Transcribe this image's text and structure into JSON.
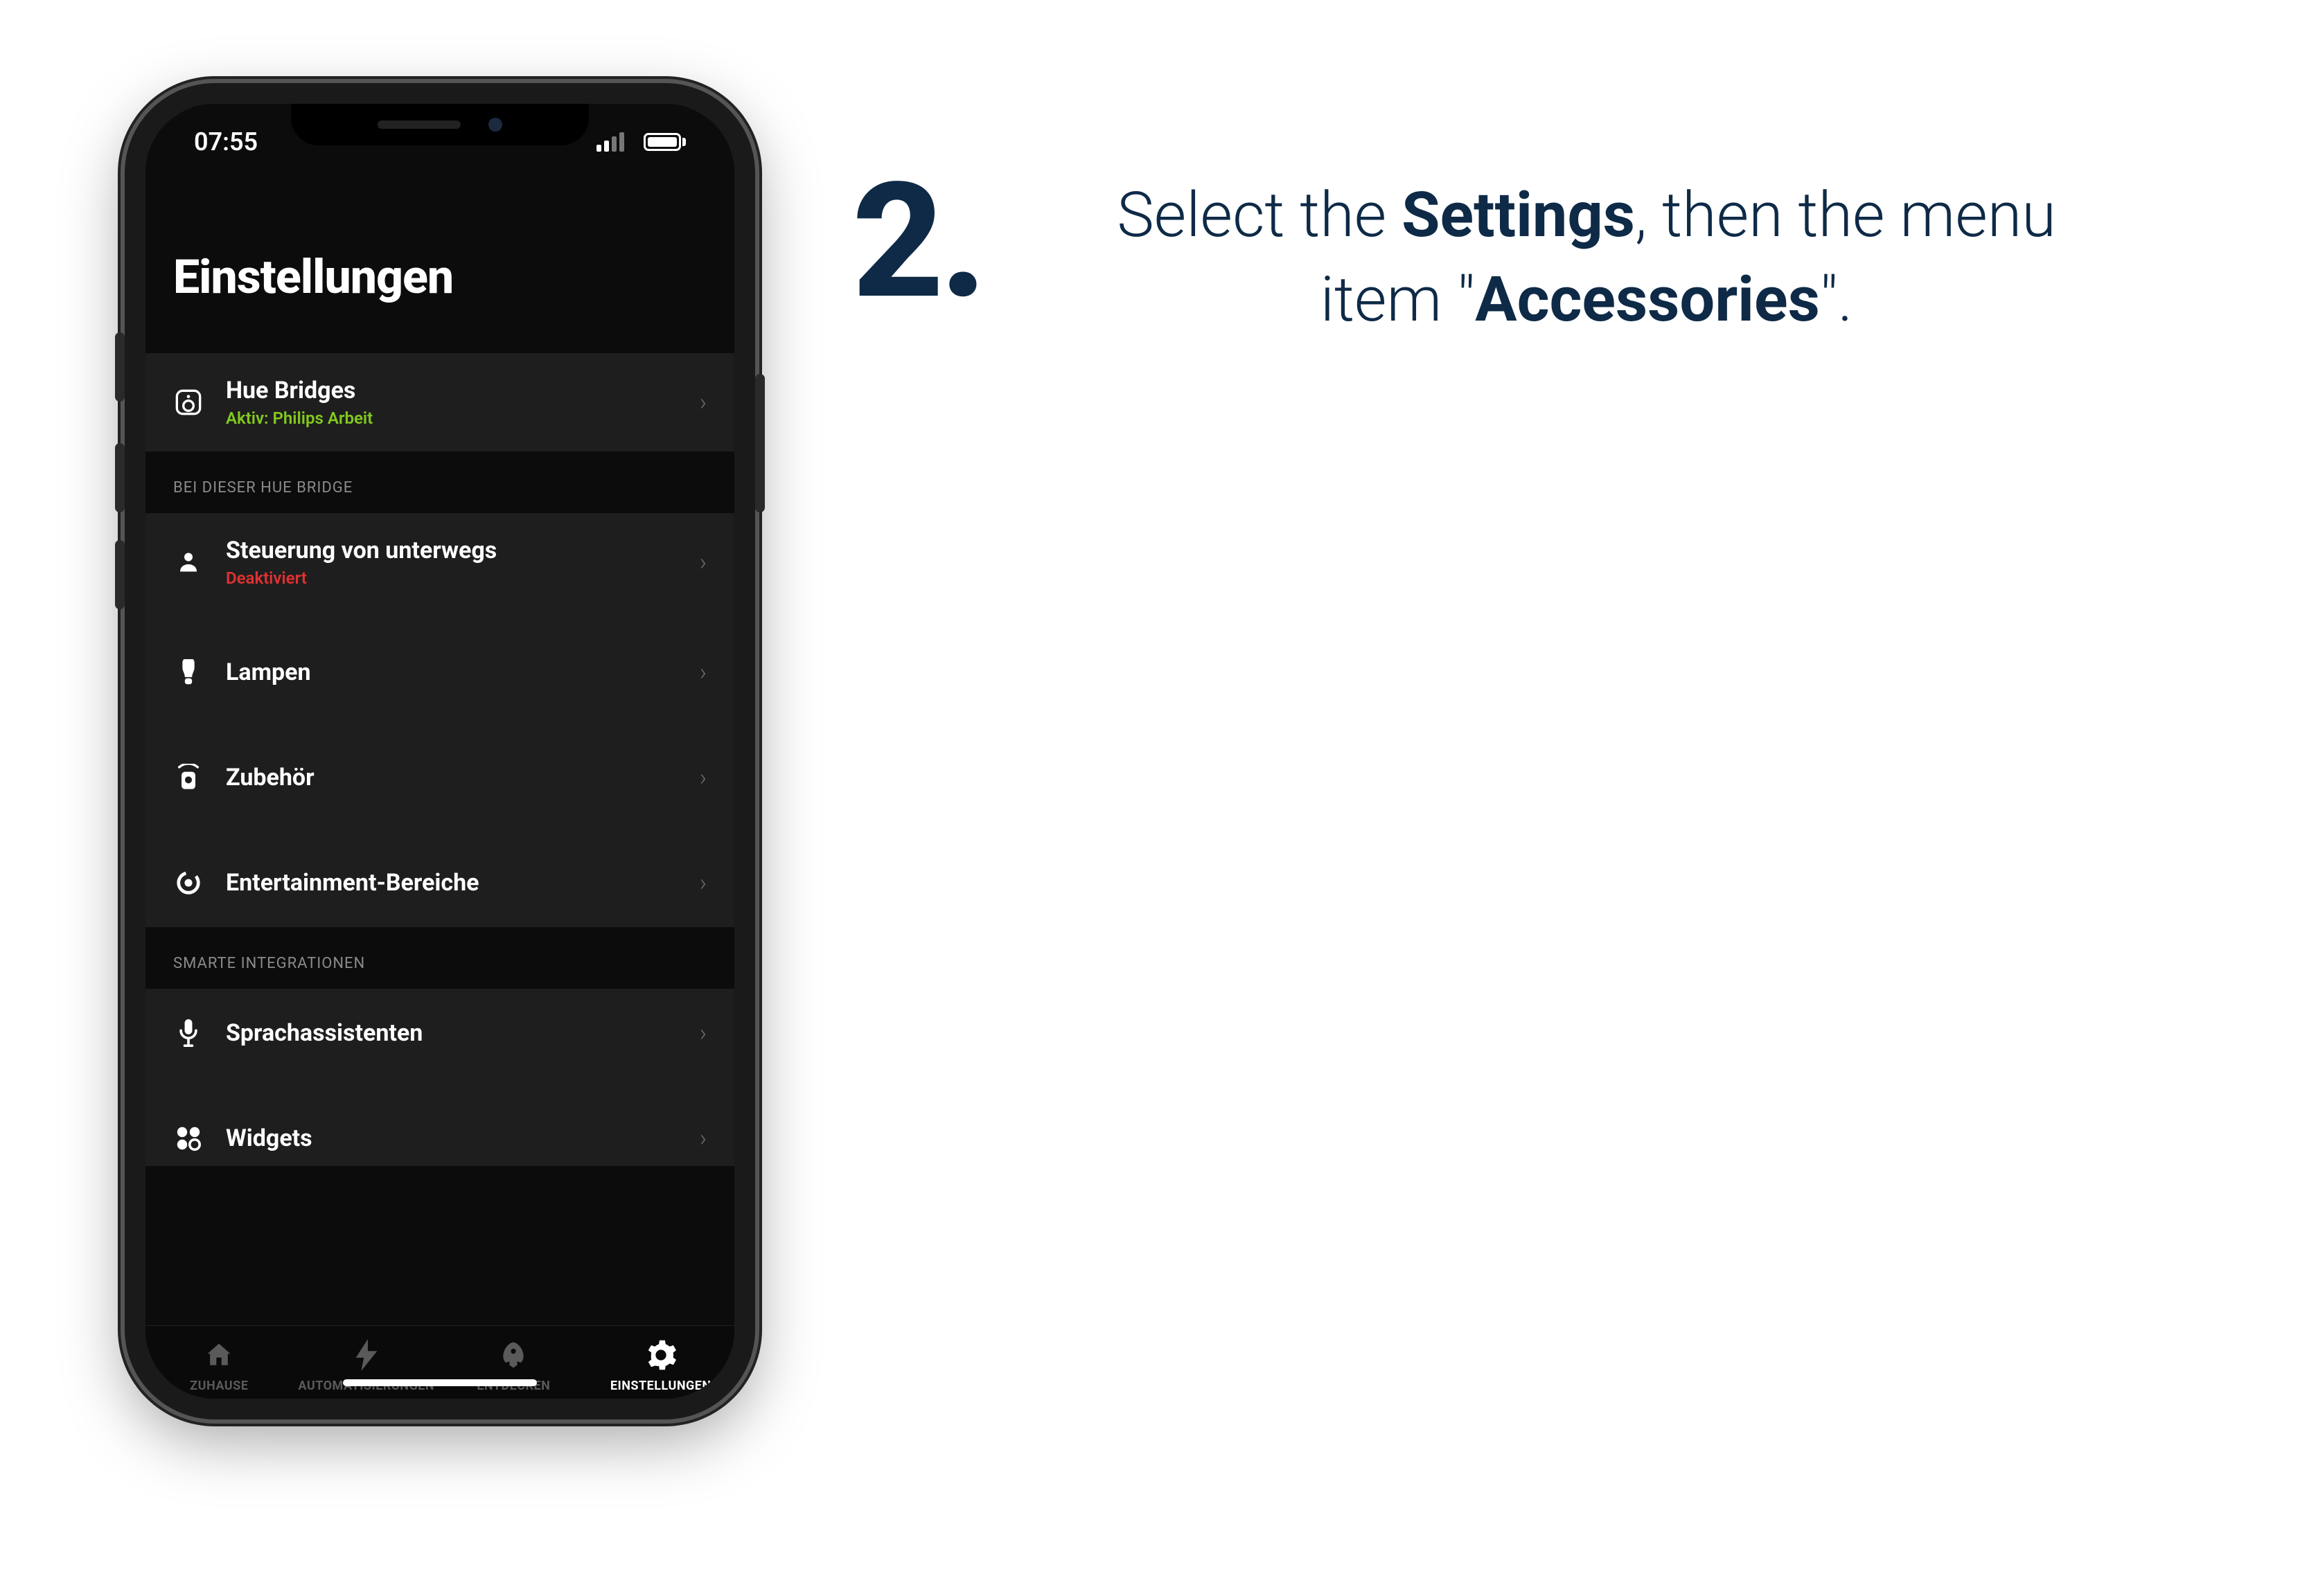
{
  "step": {
    "number": "2.",
    "text_pre": "Select the ",
    "text_bold1": "Settings",
    "text_mid": ", then the menu item \"",
    "text_bold2": "Accessories",
    "text_post": "\"."
  },
  "statusbar": {
    "time": "07:55"
  },
  "screen": {
    "title": "Einstellungen",
    "bridges": {
      "title": "Hue Bridges",
      "subtitle": "Aktiv: Philips Arbeit"
    },
    "section1_header": "BEI DIESER HUE BRIDGE",
    "section1_items": [
      {
        "label": "Steuerung von unterwegs",
        "sub": "Deaktiviert",
        "sub_class": "sec-red",
        "icon": "person-icon"
      },
      {
        "label": "Lampen",
        "icon": "bulb-icon"
      },
      {
        "label": "Zubehör",
        "icon": "accessory-icon"
      },
      {
        "label": "Entertainment-Bereiche",
        "icon": "entertainment-icon"
      }
    ],
    "section2_header": "SMARTE INTEGRATIONEN",
    "section2_items": [
      {
        "label": "Sprachassistenten",
        "icon": "mic-icon"
      },
      {
        "label": "Widgets",
        "icon": "widgets-icon"
      }
    ],
    "tabs": [
      {
        "label": "ZUHAUSE",
        "icon": "home-icon",
        "active": false
      },
      {
        "label": "AUTOMATISIERUNGEN",
        "icon": "bolt-icon",
        "active": false
      },
      {
        "label": "ENTDECKEN",
        "icon": "rocket-icon",
        "active": false
      },
      {
        "label": "EINSTELLUNGEN",
        "icon": "gear-icon",
        "active": true
      }
    ]
  }
}
